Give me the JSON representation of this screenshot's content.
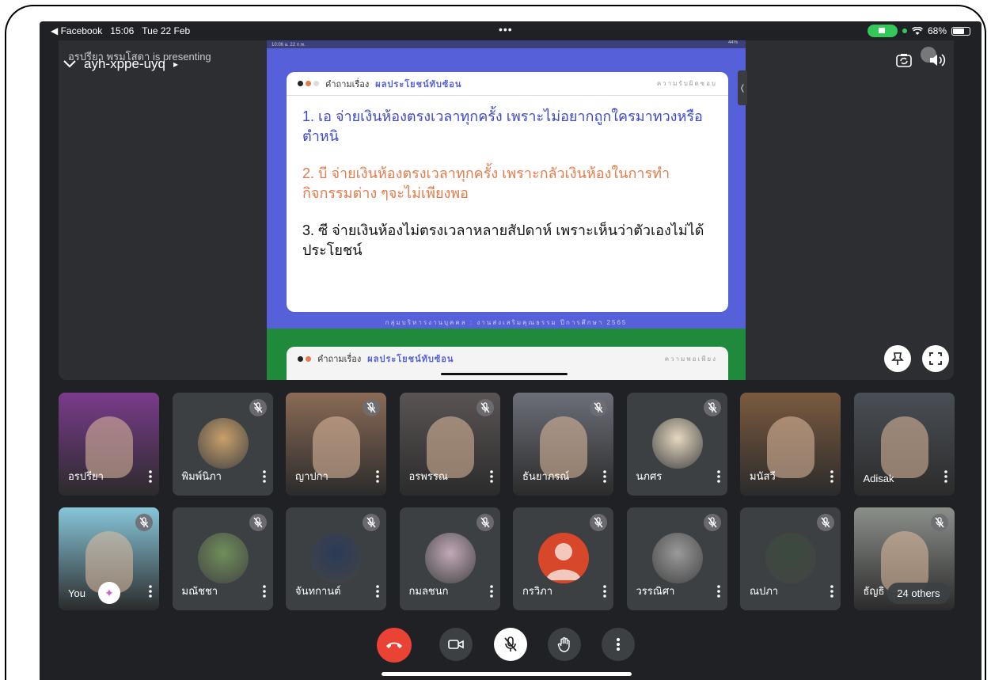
{
  "status_bar": {
    "back_app": "◀ Facebook",
    "time": "15:06",
    "date": "Tue 22 Feb",
    "dots": "•••",
    "battery": "68%",
    "battery_level": 0.68
  },
  "stage": {
    "presenter_text": "อรปรียา พรมโสดา is presenting",
    "meeting_code": "ayh-xppe-uyq",
    "meeting_code_chevron": "▸"
  },
  "slide": {
    "status_left": "10:06  a. 22 ก.พ.",
    "status_right": "44%",
    "header_prefix": "คำถามเรื่อง",
    "header_title": "ผลประโยชน์ทับซ้อน",
    "header_right": "ความรับผิดชอบ",
    "q1": "1. เอ จ่ายเงินห้องตรงเวลาทุกครั้ง เพราะไม่อยากถูกใครมาทวงหรือตำหนิ",
    "q2": "2. บี จ่ายเงินห้องตรงเวลาทุกครั้ง เพราะกลัวเงินห้องในการทำกิจกรรมต่าง ๆจะไม่เพียงพอ",
    "q3": "3. ซี จ่ายเงินห้องไม่ตรงเวลาหลายสัปดาห์ เพราะเห็นว่าตัวเองไม่ได้ประโยชน์",
    "footer": "กลุ่มบริหารงานบุคคล : งานส่งเสริมคุณธรรม     ปีการศึกษา 2565",
    "next_header_prefix": "คำถามเรื่อง",
    "next_header_title": "ผลประโยชน์ทับซ้อน",
    "next_header_right": "ความพอเพียง",
    "handle": "❬"
  },
  "participants_row1": [
    {
      "name": "อรปรียา",
      "muted": false,
      "kind": "photo",
      "bg": "#7a3b8c"
    },
    {
      "name": "พิมพ์นิภา",
      "muted": true,
      "kind": "avatar",
      "bg": "#c9a06a"
    },
    {
      "name": "ญาปกา",
      "muted": true,
      "kind": "photo",
      "bg": "#8a6b56"
    },
    {
      "name": "อรพรรณ",
      "muted": true,
      "kind": "photo",
      "bg": "#5a5454"
    },
    {
      "name": "ธันยาภรณ์",
      "muted": true,
      "kind": "photo",
      "bg": "#6c6f78"
    },
    {
      "name": "นภศร",
      "muted": true,
      "kind": "avatar",
      "bg": "#e6d8c0"
    },
    {
      "name": "มนัสวี",
      "muted": false,
      "kind": "photo",
      "bg": "#7b5a3f"
    },
    {
      "name": "Adisak",
      "muted": false,
      "kind": "photo",
      "bg": "#4a4f55"
    }
  ],
  "participants_row2": [
    {
      "name": "You",
      "muted": true,
      "kind": "photo",
      "bg": "#87c6d9"
    },
    {
      "name": "มณัชชา",
      "muted": true,
      "kind": "avatar",
      "bg": "#6f8f5a"
    },
    {
      "name": "จันทกานต์",
      "muted": true,
      "kind": "avatar",
      "bg": "#2a3b58"
    },
    {
      "name": "กมลชนก",
      "muted": true,
      "kind": "avatar",
      "bg": "#c2a9b8"
    },
    {
      "name": "กรวิภา",
      "muted": true,
      "kind": "default",
      "bg": "#d9472b"
    },
    {
      "name": "วรรณิศา",
      "muted": true,
      "kind": "avatar",
      "bg": "#9a9a9a"
    },
    {
      "name": "ณปภา",
      "muted": true,
      "kind": "avatar",
      "bg": "#3a4a3e"
    },
    {
      "name": "ธัญธิ",
      "muted": true,
      "kind": "photo",
      "bg": "#8b8f8a"
    }
  ],
  "others_label": "24 others",
  "controls": {
    "end_call": "end-call-button",
    "camera": "camera-button",
    "mic": "mic-button",
    "raise_hand": "raise-hand-button",
    "more": "more-options-button"
  },
  "colors": {
    "background": "#202124",
    "tile": "#3c4043",
    "end_call": "#ea4335",
    "accent": "#5560d6",
    "orange": "#e37b4b",
    "green": "#34c759"
  }
}
